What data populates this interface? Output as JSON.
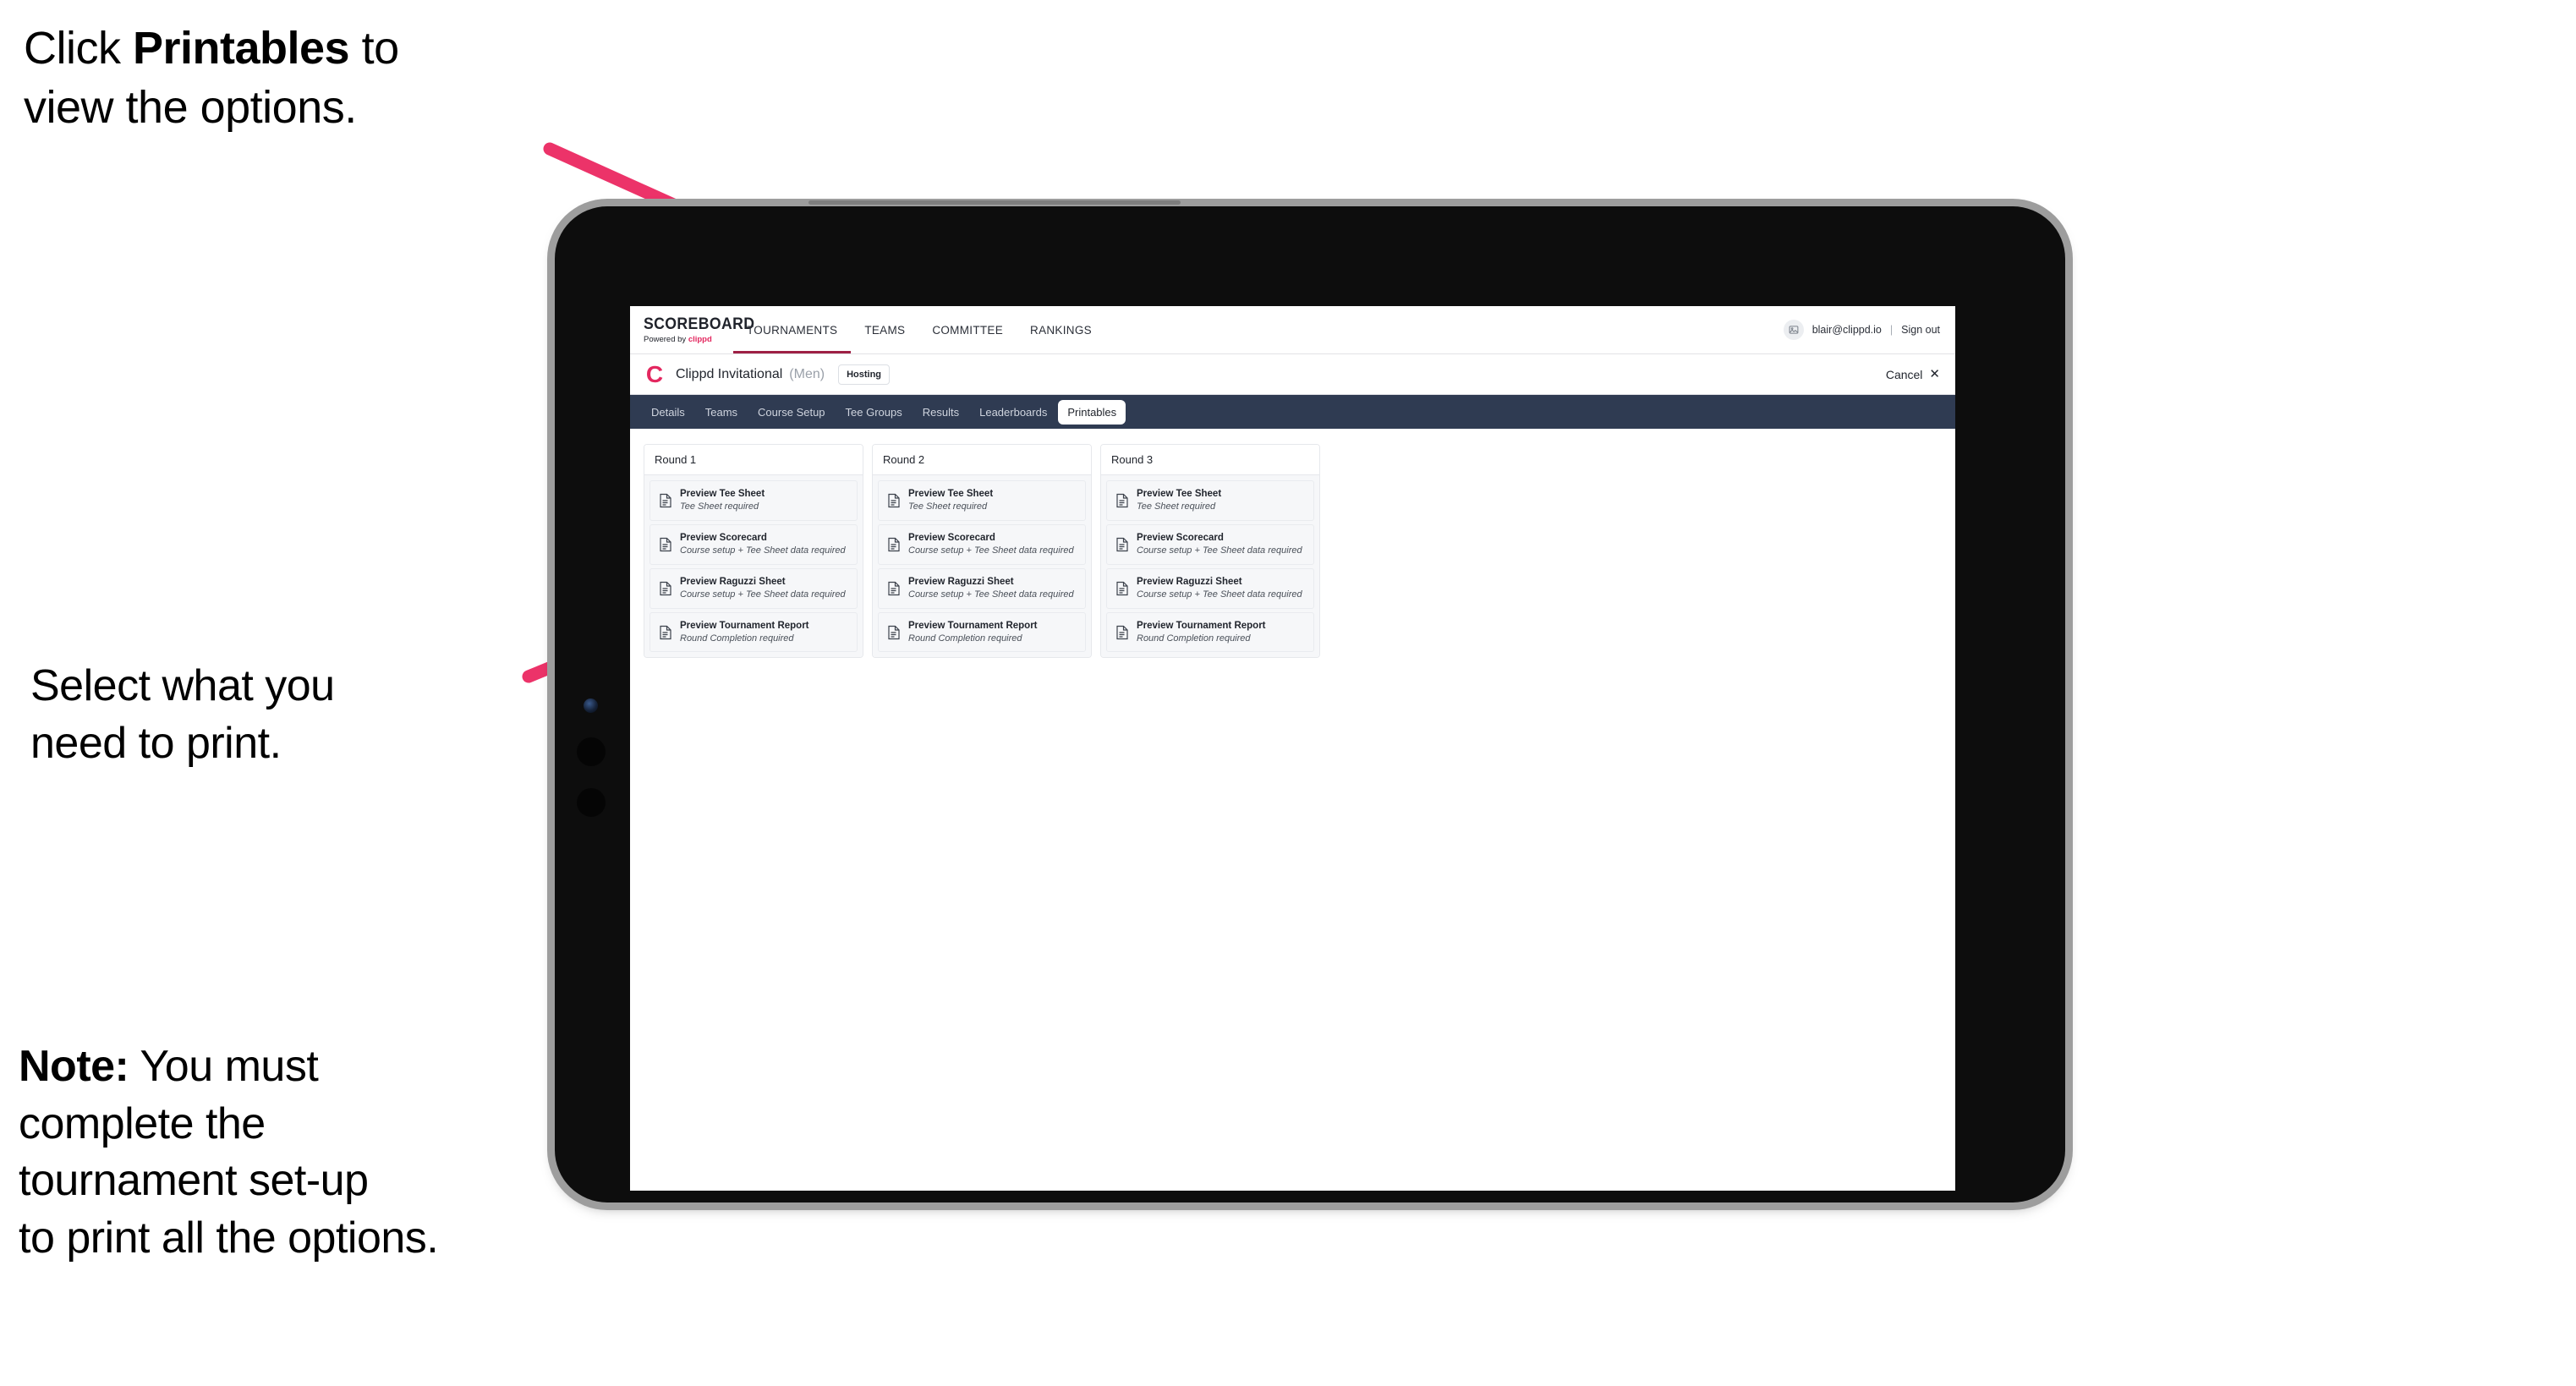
{
  "annotations": {
    "click_printables": "Click Printables to\nview the options.",
    "click_printables_prefix": "Click ",
    "click_printables_bold": "Printables",
    "click_printables_suffix": " to\nview the options.",
    "select_print": "Select what you\n need to print.",
    "note_bold": "Note:",
    "note_rest": " You must\ncomplete the\ntournament set-up\nto print all the options."
  },
  "colors": {
    "arrow_pink": "#ec3369",
    "brand_accent": "#e3275f",
    "subtab_bar": "#2f3b52",
    "nav_underline": "#9e2045",
    "tablet_body": "#0d0d0d",
    "tablet_bezel": "#9d9d9d"
  },
  "app": {
    "brand": {
      "title": "SCOREBOARD",
      "powered_by": "Powered by ",
      "powered_brand": "clippd"
    },
    "main_nav": [
      {
        "label": "TOURNAMENTS",
        "active": true
      },
      {
        "label": "TEAMS",
        "active": false
      },
      {
        "label": "COMMITTEE",
        "active": false
      },
      {
        "label": "RANKINGS",
        "active": false
      }
    ],
    "account": {
      "avatar_icon": "user-avatar-icon",
      "email": "blair@clippd.io",
      "separator": "|",
      "sign_out": "Sign out"
    },
    "tournament_bar": {
      "logo_letter": "C",
      "name": "Clippd Invitational",
      "gender": "(Men)",
      "badge": "Hosting",
      "cancel": "Cancel",
      "cancel_icon": "close-icon"
    },
    "sub_tabs": [
      {
        "label": "Details",
        "active": false
      },
      {
        "label": "Teams",
        "active": false
      },
      {
        "label": "Course Setup",
        "active": false
      },
      {
        "label": "Tee Groups",
        "active": false
      },
      {
        "label": "Results",
        "active": false
      },
      {
        "label": "Leaderboards",
        "active": false
      },
      {
        "label": "Printables",
        "active": true
      }
    ],
    "rounds": [
      {
        "title": "Round 1",
        "items": [
          {
            "title": "Preview Tee Sheet",
            "sub": "Tee Sheet required"
          },
          {
            "title": "Preview Scorecard",
            "sub": "Course setup + Tee Sheet data required"
          },
          {
            "title": "Preview Raguzzi Sheet",
            "sub": "Course setup + Tee Sheet data required"
          },
          {
            "title": "Preview Tournament Report",
            "sub": "Round Completion required"
          }
        ]
      },
      {
        "title": "Round 2",
        "items": [
          {
            "title": "Preview Tee Sheet",
            "sub": "Tee Sheet required"
          },
          {
            "title": "Preview Scorecard",
            "sub": "Course setup + Tee Sheet data required"
          },
          {
            "title": "Preview Raguzzi Sheet",
            "sub": "Course setup + Tee Sheet data required"
          },
          {
            "title": "Preview Tournament Report",
            "sub": "Round Completion required"
          }
        ]
      },
      {
        "title": "Round 3",
        "items": [
          {
            "title": "Preview Tee Sheet",
            "sub": "Tee Sheet required"
          },
          {
            "title": "Preview Scorecard",
            "sub": "Course setup + Tee Sheet data required"
          },
          {
            "title": "Preview Raguzzi Sheet",
            "sub": "Course setup + Tee Sheet data required"
          },
          {
            "title": "Preview Tournament Report",
            "sub": "Round Completion required"
          }
        ]
      }
    ]
  }
}
